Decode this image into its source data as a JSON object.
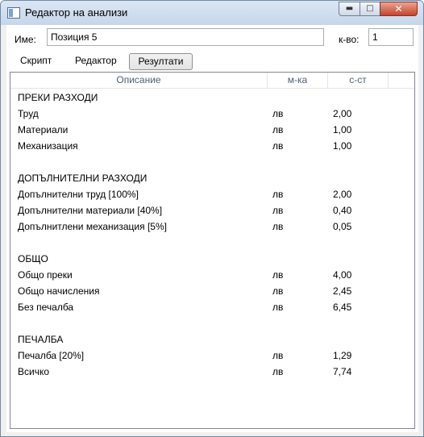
{
  "window": {
    "title": "Редактор на анализи",
    "min_glyph": "▬",
    "max_glyph": "□",
    "close_glyph": "✕"
  },
  "form": {
    "name_label": "Име:",
    "name_value": "Позиция 5",
    "qty_label": "к-во:",
    "qty_value": "1"
  },
  "tabs": {
    "script": "Скрипт",
    "editor": "Редактор",
    "results": "Резултати"
  },
  "grid": {
    "headers": {
      "description": "Описание",
      "unit": "м-ка",
      "cost": "с-ст"
    },
    "rows": [
      {
        "desc": "ПРЕКИ РАЗХОДИ",
        "unit": "",
        "cost": ""
      },
      {
        "desc": "Труд",
        "unit": "лв",
        "cost": "2,00"
      },
      {
        "desc": "Материали",
        "unit": "лв",
        "cost": "1,00"
      },
      {
        "desc": "Механизация",
        "unit": "лв",
        "cost": "1,00"
      },
      {
        "desc": "",
        "unit": "",
        "cost": ""
      },
      {
        "desc": "ДОПЪЛНИТЕЛНИ РАЗХОДИ",
        "unit": "",
        "cost": ""
      },
      {
        "desc": "Допълнителни труд [100%]",
        "unit": "лв",
        "cost": "2,00"
      },
      {
        "desc": "Допълнителни материали [40%]",
        "unit": "лв",
        "cost": "0,40"
      },
      {
        "desc": "Допълнитлени механизация [5%]",
        "unit": "лв",
        "cost": "0,05"
      },
      {
        "desc": "",
        "unit": "",
        "cost": ""
      },
      {
        "desc": "ОБЩО",
        "unit": "",
        "cost": ""
      },
      {
        "desc": "Общо преки",
        "unit": "лв",
        "cost": "4,00"
      },
      {
        "desc": "Общо начисления",
        "unit": "лв",
        "cost": "2,45"
      },
      {
        "desc": "Без печалба",
        "unit": "лв",
        "cost": "6,45"
      },
      {
        "desc": "",
        "unit": "",
        "cost": ""
      },
      {
        "desc": "ПЕЧАЛБА",
        "unit": "",
        "cost": ""
      },
      {
        "desc": "Печалба [20%]",
        "unit": "лв",
        "cost": "1,29"
      },
      {
        "desc": "Всичко",
        "unit": "лв",
        "cost": "7,74"
      }
    ]
  }
}
